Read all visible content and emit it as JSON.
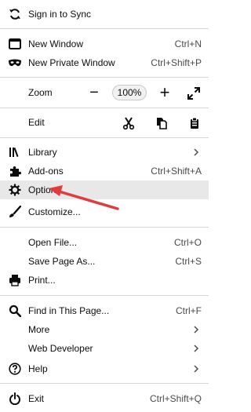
{
  "menu": {
    "sync": {
      "label": "Sign in to Sync",
      "icon": "sync-icon"
    },
    "new_window": {
      "label": "New Window",
      "shortcut": "Ctrl+N",
      "icon": "new-window-icon"
    },
    "new_private_window": {
      "label": "New Private Window",
      "shortcut": "Ctrl+Shift+P",
      "icon": "private-mask-icon"
    },
    "zoom": {
      "label": "Zoom",
      "minus": "−",
      "value": "100%",
      "plus": "+",
      "icon_fullscreen": "fullscreen-icon"
    },
    "edit": {
      "label": "Edit",
      "cut_icon": "cut-icon",
      "copy_icon": "copy-icon",
      "paste_icon": "paste-icon"
    },
    "library": {
      "label": "Library",
      "icon": "library-icon"
    },
    "addons": {
      "label": "Add-ons",
      "shortcut": "Ctrl+Shift+A",
      "icon": "puzzle-icon"
    },
    "options": {
      "label": "Options",
      "icon": "gear-icon"
    },
    "customize": {
      "label": "Customize...",
      "icon": "brush-icon"
    },
    "open_file": {
      "label": "Open File...",
      "shortcut": "Ctrl+O"
    },
    "save_page": {
      "label": "Save Page As...",
      "shortcut": "Ctrl+S"
    },
    "print": {
      "label": "Print...",
      "icon": "printer-icon"
    },
    "find": {
      "label": "Find in This Page...",
      "shortcut": "Ctrl+F",
      "icon": "search-icon"
    },
    "more": {
      "label": "More"
    },
    "web_developer": {
      "label": "Web Developer"
    },
    "help": {
      "label": "Help",
      "icon": "help-icon"
    },
    "exit": {
      "label": "Exit",
      "shortcut": "Ctrl+Shift+Q",
      "icon": "power-icon"
    }
  },
  "annotation": {
    "arrow_color": "#e03c3c"
  }
}
